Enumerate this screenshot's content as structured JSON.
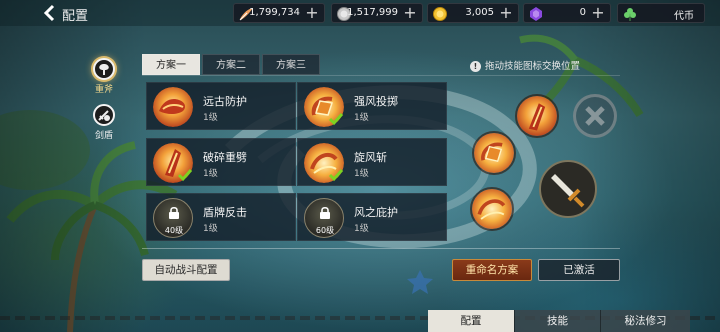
{
  "header": {
    "title": "配置",
    "back_icon": "back-chevron-icon"
  },
  "resources": [
    {
      "name": "feather",
      "icon": "feather-icon",
      "value": "1,799,734",
      "color": "#f0a060"
    },
    {
      "name": "silver",
      "icon": "silver-coin-icon",
      "value": "1,517,999",
      "color": "#c8c8c8"
    },
    {
      "name": "gold",
      "icon": "gold-coin-icon",
      "value": "3,005",
      "color": "#f2c232"
    },
    {
      "name": "gem",
      "icon": "purple-gem-icon",
      "value": "0",
      "color": "#8a4ae0"
    },
    {
      "name": "token",
      "icon": "clover-icon",
      "label": "代币",
      "color": "#6acf6a"
    }
  ],
  "weapons": [
    {
      "label": "重斧",
      "icon": "axe-icon",
      "active": true
    },
    {
      "label": "剑盾",
      "icon": "sword-shield-icon",
      "active": false
    }
  ],
  "tabs": [
    {
      "label": "方案一",
      "active": true
    },
    {
      "label": "方案二",
      "active": false
    },
    {
      "label": "方案三",
      "active": false
    }
  ],
  "hint": "拖动技能图标交换位置",
  "skills": [
    {
      "name": "远古防护",
      "level": "1级",
      "icon": "ancient-guard-icon",
      "equipped": false,
      "locked": false
    },
    {
      "name": "强风投掷",
      "level": "1级",
      "icon": "wind-throw-icon",
      "equipped": true,
      "locked": false
    },
    {
      "name": "破碎重劈",
      "level": "1级",
      "icon": "shatter-cleave-icon",
      "equipped": true,
      "locked": false
    },
    {
      "name": "旋风斩",
      "level": "1级",
      "icon": "whirlwind-slash-icon",
      "equipped": true,
      "locked": false
    },
    {
      "name": "盾牌反击",
      "level": "1级",
      "icon": "shield-counter-icon",
      "equipped": false,
      "locked": true,
      "unlock_level": "40级"
    },
    {
      "name": "风之庇护",
      "level": "1级",
      "icon": "wind-shelter-icon",
      "equipped": false,
      "locked": true,
      "unlock_level": "60级"
    }
  ],
  "equipped_slots": [
    "shatter-cleave-icon",
    "wind-throw-icon",
    "whirlwind-slash-icon",
    "empty-slot-x-icon",
    "basic-attack-sword-icon"
  ],
  "buttons": {
    "auto_battle": "自动战斗配置",
    "rename": "重命名方案",
    "activated": "已激活"
  },
  "bottom_nav": [
    {
      "label": "配置",
      "active": true
    },
    {
      "label": "技能",
      "active": false
    },
    {
      "label": "秘法修习",
      "active": false
    }
  ]
}
